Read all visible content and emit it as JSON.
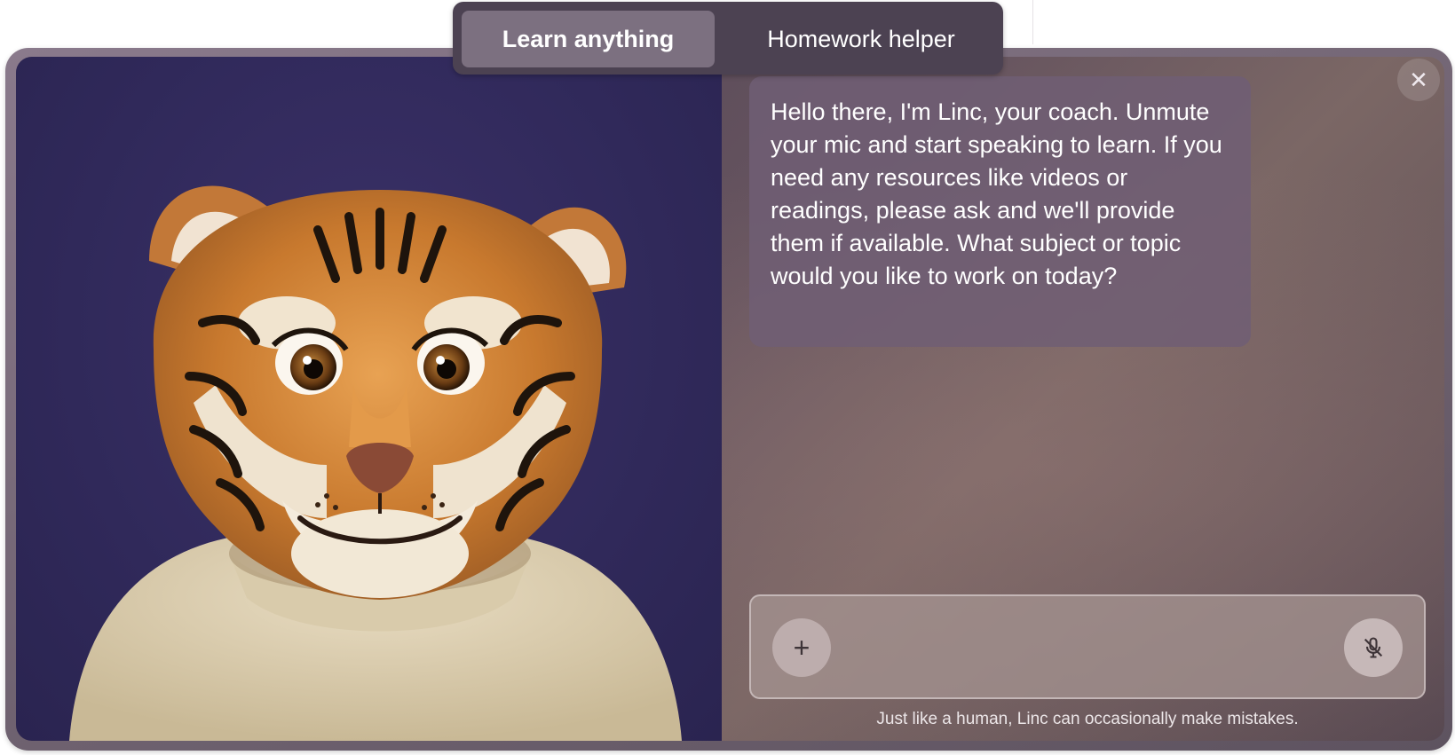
{
  "tabs": [
    {
      "label": "Learn anything",
      "active": true
    },
    {
      "label": "Homework helper",
      "active": false
    }
  ],
  "chat": {
    "coach_message": "Hello there, I'm Linc, your coach. Unmute your mic and start speaking to learn. If you need any resources like videos or readings, please ask and we'll provide them if available. What subject or topic would you like to work on today?"
  },
  "input": {
    "add_icon": "plus-icon",
    "mic_icon": "mic-muted-icon"
  },
  "close_icon": "close-icon",
  "disclaimer": "Just like a human, Linc can occasionally make mistakes.",
  "colors": {
    "avatar_background": "#30295a",
    "panel_background": "#66545f",
    "active_tab": "#7c7080",
    "bubble": "#705e74"
  }
}
